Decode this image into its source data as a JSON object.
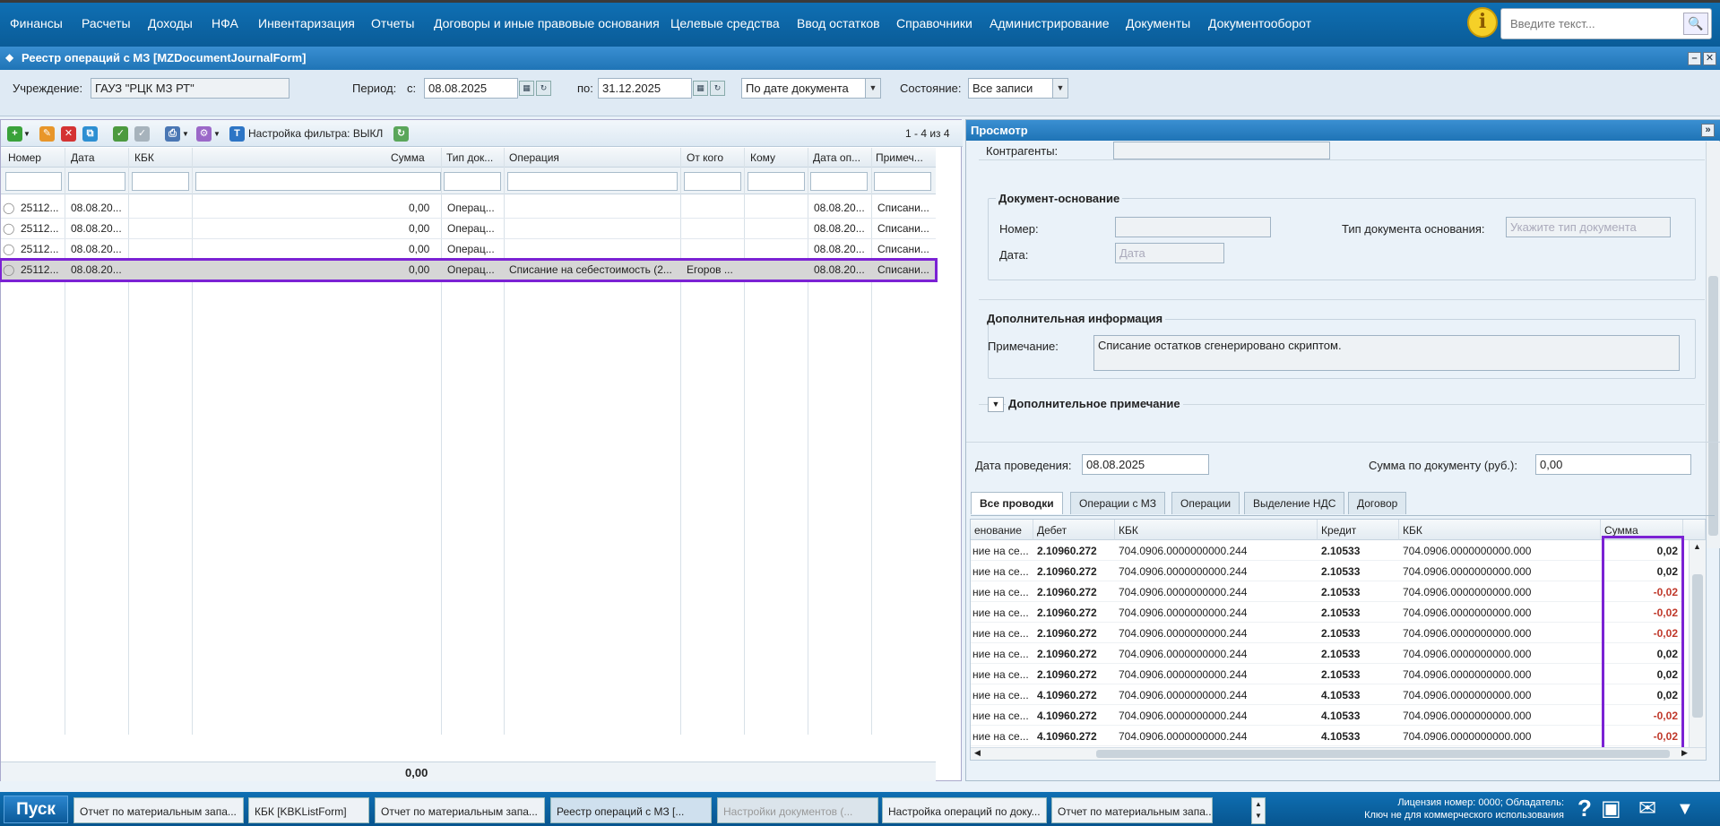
{
  "top_menu": [
    "Финансы",
    "Расчеты",
    "Доходы",
    "НФА",
    "Инвентаризация",
    "Отчеты",
    "Договоры и иные правовые основания",
    "Целевые средства",
    "Ввод остатков",
    "Справочники",
    "Администрирование",
    "Документы",
    "Документооборот"
  ],
  "search": {
    "placeholder": "Введите текст..."
  },
  "window": {
    "title": "Реестр операций с МЗ [MZDocumentJournalForm]"
  },
  "params": {
    "org_label": "Учреждение:",
    "org_value": "ГАУЗ \"РЦК МЗ РТ\"",
    "period_label": "Период:",
    "from_label": "с:",
    "from_value": "08.08.2025",
    "to_label": "по:",
    "to_value": "31.12.2025",
    "date_mode": "По дате документа",
    "state_label": "Состояние:",
    "state_value": "Все записи"
  },
  "toolbar": {
    "filter_label": "Настройка фильтра: ВЫКЛ",
    "count": "1 - 4 из 4"
  },
  "grid": {
    "columns": [
      "Номер",
      "Дата",
      "КБК",
      "Сумма",
      "Тип док...",
      "Операция",
      "От кого",
      "Кому",
      "Дата оп...",
      "Примеч..."
    ],
    "rows": [
      {
        "num": "25112...",
        "date": "08.08.20...",
        "kbk": "",
        "sum": "0,00",
        "type": "Операц...",
        "op": "",
        "from": "",
        "to": "",
        "opdate": "08.08.20...",
        "note": "Списани..."
      },
      {
        "num": "25112...",
        "date": "08.08.20...",
        "kbk": "",
        "sum": "0,00",
        "type": "Операц...",
        "op": "",
        "from": "",
        "to": "",
        "opdate": "08.08.20...",
        "note": "Списани..."
      },
      {
        "num": "25112...",
        "date": "08.08.20...",
        "kbk": "",
        "sum": "0,00",
        "type": "Операц...",
        "op": "",
        "from": "",
        "to": "",
        "opdate": "08.08.20...",
        "note": "Списани..."
      },
      {
        "num": "25112...",
        "date": "08.08.20...",
        "kbk": "",
        "sum": "0,00",
        "type": "Операц...",
        "op": "Списание на себестоимость (2...",
        "from": "Егоров ...",
        "to": "",
        "opdate": "08.08.20...",
        "note": "Списани..."
      }
    ],
    "total": "0,00"
  },
  "view": {
    "title": "Просмотр",
    "counterparties_label": "Контрагенты:",
    "basis_legend": "Документ-основание",
    "basis_number_label": "Номер:",
    "basis_type_label": "Тип документа основания:",
    "basis_type_placeholder": "Укажите тип документа",
    "basis_date_label": "Дата:",
    "basis_date_placeholder": "Дата",
    "extra_legend": "Дополнительная информация",
    "note_label": "Примечание:",
    "note_value": "Списание остатков сгенерировано скриптом.",
    "extra_note_label": "Дополнительное примечание",
    "post_date_label": "Дата проведения:",
    "post_date_value": "08.08.2025",
    "doc_sum_label": "Сумма по документу (руб.):",
    "doc_sum_value": "0,00"
  },
  "tabs": [
    "Все проводки",
    "Операции с МЗ",
    "Операции",
    "Выделение НДС",
    "Договор"
  ],
  "postings": {
    "columns": [
      "енование",
      "Дебет",
      "КБК",
      "Кредит",
      "КБК",
      "Сумма"
    ],
    "rows": [
      {
        "name": "ние на се...",
        "debit": "2.10960.272",
        "kbk_d": "704.0906.0000000000.244",
        "credit": "2.10533",
        "kbk_c": "704.0906.0000000000.000",
        "sum": "0,02"
      },
      {
        "name": "ние на се...",
        "debit": "2.10960.272",
        "kbk_d": "704.0906.0000000000.244",
        "credit": "2.10533",
        "kbk_c": "704.0906.0000000000.000",
        "sum": "0,02"
      },
      {
        "name": "ние на се...",
        "debit": "2.10960.272",
        "kbk_d": "704.0906.0000000000.244",
        "credit": "2.10533",
        "kbk_c": "704.0906.0000000000.000",
        "sum": "-0,02"
      },
      {
        "name": "ние на се...",
        "debit": "2.10960.272",
        "kbk_d": "704.0906.0000000000.244",
        "credit": "2.10533",
        "kbk_c": "704.0906.0000000000.000",
        "sum": "-0,02"
      },
      {
        "name": "ние на се...",
        "debit": "2.10960.272",
        "kbk_d": "704.0906.0000000000.244",
        "credit": "2.10533",
        "kbk_c": "704.0906.0000000000.000",
        "sum": "-0,02"
      },
      {
        "name": "ние на се...",
        "debit": "2.10960.272",
        "kbk_d": "704.0906.0000000000.244",
        "credit": "2.10533",
        "kbk_c": "704.0906.0000000000.000",
        "sum": "0,02"
      },
      {
        "name": "ние на се...",
        "debit": "2.10960.272",
        "kbk_d": "704.0906.0000000000.244",
        "credit": "2.10533",
        "kbk_c": "704.0906.0000000000.000",
        "sum": "0,02"
      },
      {
        "name": "ние на се...",
        "debit": "4.10960.272",
        "kbk_d": "704.0906.0000000000.244",
        "credit": "4.10533",
        "kbk_c": "704.0906.0000000000.000",
        "sum": "0,02"
      },
      {
        "name": "ние на се...",
        "debit": "4.10960.272",
        "kbk_d": "704.0906.0000000000.244",
        "credit": "4.10533",
        "kbk_c": "704.0906.0000000000.000",
        "sum": "-0,02"
      },
      {
        "name": "ние на се...",
        "debit": "4.10960.272",
        "kbk_d": "704.0906.0000000000.244",
        "credit": "4.10533",
        "kbk_c": "704.0906.0000000000.000",
        "sum": "-0,02"
      }
    ]
  },
  "taskbar": {
    "start": "Пуск",
    "items": [
      "Отчет по материальным запа...",
      "КБК [KBKListForm]",
      "Отчет по материальным запа...",
      "Реестр операций с МЗ [...",
      "Настройки документов (...",
      "Настройка операций по доку...",
      "Отчет по материальным запа..."
    ],
    "license": "Лицензия номер: 0000; Обладатель:",
    "license2": "Ключ не для коммерческого использования"
  },
  "colors": {
    "menu_bg": "#0f6fb3",
    "highlight": "#7b22d4",
    "negative": "#c0392b"
  }
}
